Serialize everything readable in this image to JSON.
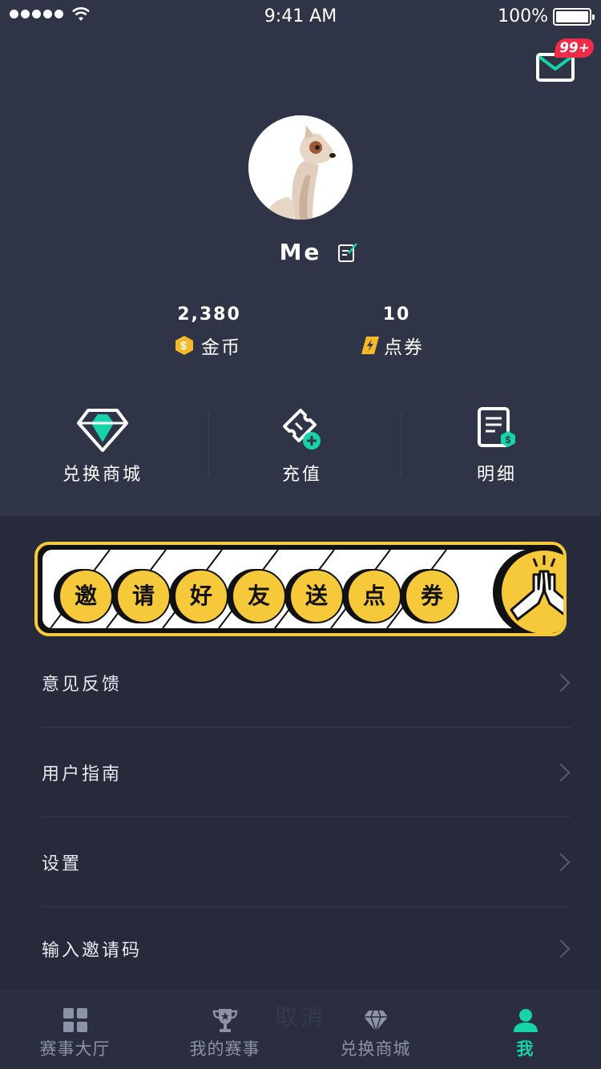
{
  "status_bar": {
    "time": "9:41 AM",
    "battery": "100%"
  },
  "mail": {
    "badge": "99+"
  },
  "profile": {
    "name": "Me"
  },
  "stats": {
    "coins": {
      "value": "2,380",
      "label": "金币"
    },
    "tickets": {
      "value": "10",
      "label": "点券"
    }
  },
  "actions": [
    {
      "label": "兑换商城",
      "icon": "diamond-icon"
    },
    {
      "label": "充值",
      "icon": "ticket-plus-icon"
    },
    {
      "label": "明细",
      "icon": "receipt-icon"
    }
  ],
  "banner": {
    "chars": [
      "邀",
      "请",
      "好",
      "友",
      "送",
      "点",
      "券"
    ]
  },
  "menu": [
    {
      "label": "意见反馈"
    },
    {
      "label": "用户指南"
    },
    {
      "label": "设置"
    },
    {
      "label": "输入邀请码"
    }
  ],
  "ghost_text": "取消",
  "tabs": [
    {
      "label": "赛事大厅",
      "icon": "grid-icon"
    },
    {
      "label": "我的赛事",
      "icon": "trophy-icon"
    },
    {
      "label": "兑换商城",
      "icon": "diamond-icon"
    },
    {
      "label": "我",
      "icon": "user-icon",
      "active": true
    }
  ],
  "colors": {
    "accent": "#17d4a8",
    "gold": "#f5c93a",
    "badge": "#ee2c4a",
    "background": "#262a3a",
    "header": "#2f3446"
  }
}
